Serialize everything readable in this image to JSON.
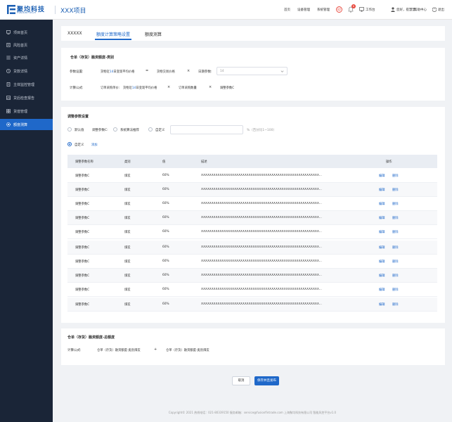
{
  "header": {
    "logo_cn": "聚均科技",
    "logo_en": "FUSION TECH",
    "project": "XXX项目",
    "nav": [
      "首页",
      "设备管理",
      "系统管理"
    ],
    "badge_count": "6",
    "workbench": "工作台",
    "greeting": "您好，崔慧慧",
    "help": "帮助中心",
    "logout": "退出"
  },
  "sidebar": {
    "items": [
      {
        "label": "项目首页",
        "icon": "monitor-icon"
      },
      {
        "label": "风险首页",
        "icon": "document-icon"
      },
      {
        "label": "资产详情",
        "icon": "list-icon"
      },
      {
        "label": "贷款详情",
        "icon": "clock-icon"
      },
      {
        "label": "主体监控管理",
        "icon": "building-icon"
      },
      {
        "label": "贷后检查报告",
        "icon": "report-icon"
      },
      {
        "label": "货值管理",
        "icon": "grid-icon"
      },
      {
        "label": "额度测算",
        "icon": "gear-icon"
      }
    ]
  },
  "tabs": [
    "XXXXX",
    "额度计算策略设置",
    "额度测算"
  ],
  "category_section": {
    "title": "仓单（存货）融资额度-类别",
    "param_label": "参数设置:",
    "param1_prefix": "货物近",
    "param1_highlight": "14",
    "param1_suffix": "日变现平均价格",
    "op1": "=",
    "param2": "货物交易价格",
    "op2": "×",
    "days_label": "日期参数:",
    "days_value": "14",
    "formula_label": "计算公式:",
    "f1": "订单采购单价:",
    "f2_prefix": "货物近",
    "f2_highlight": "14",
    "f2_suffix": "日变现平均价格",
    "op3": "×",
    "f3": "订单采购数量",
    "op4": "×",
    "f4": "调整参数C"
  },
  "adjust_section": {
    "title": "调整参数设置",
    "options": [
      "默认值",
      "调整参数C:",
      "系统算法推荐",
      "自定义"
    ],
    "percent_hint": "%（百分比1~100）",
    "custom_label": "自定义",
    "add_link": "添加",
    "columns": [
      "调整参数名称",
      "类别",
      "值",
      "描述",
      "操作"
    ],
    "rows": [
      {
        "name": "调整参数C",
        "category": "煤炭",
        "value": "60%",
        "desc": "XXXXXXXXXXXXXXXXXXXXXXXXXXXXXXXXXXXXXXXXXXXXXXXXXXXXXXXXX...",
        "edit": "编辑",
        "delete": "删除"
      },
      {
        "name": "调整参数C",
        "category": "煤炭",
        "value": "60%",
        "desc": "XXXXXXXXXXXXXXXXXXXXXXXXXXXXXXXXXXXXXXXXXXXXXXXXXXXXXXXXX...",
        "edit": "编辑",
        "delete": "删除"
      },
      {
        "name": "调整参数C",
        "category": "煤炭",
        "value": "60%",
        "desc": "XXXXXXXXXXXXXXXXXXXXXXXXXXXXXXXXXXXXXXXXXXXXXXXXXXXXXXXXX...",
        "edit": "编辑",
        "delete": "删除"
      },
      {
        "name": "调整参数C",
        "category": "煤炭",
        "value": "60%",
        "desc": "XXXXXXXXXXXXXXXXXXXXXXXXXXXXXXXXXXXXXXXXXXXXXXXXXXXXXXXXX...",
        "edit": "编辑",
        "delete": "删除"
      },
      {
        "name": "调整参数C",
        "category": "煤炭",
        "value": "60%",
        "desc": "XXXXXXXXXXXXXXXXXXXXXXXXXXXXXXXXXXXXXXXXXXXXXXXXXXXXXXXXX...",
        "edit": "编辑",
        "delete": "删除"
      },
      {
        "name": "调整参数C",
        "category": "煤炭",
        "value": "60%",
        "desc": "XXXXXXXXXXXXXXXXXXXXXXXXXXXXXXXXXXXXXXXXXXXXXXXXXXXXXXXXX...",
        "edit": "编辑",
        "delete": "删除"
      },
      {
        "name": "调整参数C",
        "category": "煤炭",
        "value": "60%",
        "desc": "XXXXXXXXXXXXXXXXXXXXXXXXXXXXXXXXXXXXXXXXXXXXXXXXXXXXXXXXX...",
        "edit": "编辑",
        "delete": "删除"
      },
      {
        "name": "调整参数C",
        "category": "煤炭",
        "value": "60%",
        "desc": "XXXXXXXXXXXXXXXXXXXXXXXXXXXXXXXXXXXXXXXXXXXXXXXXXXXXXXXXX...",
        "edit": "编辑",
        "delete": "删除"
      },
      {
        "name": "调整参数C",
        "category": "煤炭",
        "value": "60%",
        "desc": "XXXXXXXXXXXXXXXXXXXXXXXXXXXXXXXXXXXXXXXXXXXXXXXXXXXXXXXXX...",
        "edit": "编辑",
        "delete": "删除"
      },
      {
        "name": "调整参数C",
        "category": "煤炭",
        "value": "60%",
        "desc": "XXXXXXXXXXXXXXXXXXXXXXXXXXXXXXXXXXXXXXXXXXXXXXXXXXXXXXXXX...",
        "edit": "编辑",
        "delete": "删除"
      }
    ]
  },
  "total_section": {
    "title": "仓单（存货）融资额度-总额度",
    "formula_label": "计算公式:",
    "f1": "仓单（存货）融资额度-类别煤炭",
    "op": "+",
    "f2": "仓单（存货）融资额度-类别煤炭"
  },
  "buttons": {
    "cancel": "取消",
    "save": "保存并且发布"
  },
  "footer": "Copyright© 2021  热线电话：021-80339150  服务邮箱：service@fusionfintrade.com  上海聚均科技有限公司 智能风控平台v1.0",
  "colors": {
    "primary": "#1f68c9",
    "sidebar_bg": "#1a2537",
    "page_bg": "#f0f2f5",
    "badge": "#e94a3f"
  }
}
